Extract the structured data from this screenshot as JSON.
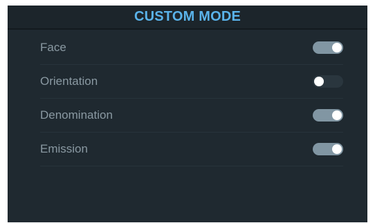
{
  "header": {
    "title": "CUSTOM MODE"
  },
  "settings": [
    {
      "label": "Face",
      "enabled": true
    },
    {
      "label": "Orientation",
      "enabled": false
    },
    {
      "label": "Denomination",
      "enabled": true
    },
    {
      "label": "Emission",
      "enabled": true
    }
  ],
  "colors": {
    "panel_background": "#1f2930",
    "title_accent": "#5ab3ea",
    "label_text": "#8a99a2",
    "toggle_on": "#8196a3",
    "toggle_off": "#2a363e",
    "knob": "#ffffff"
  }
}
